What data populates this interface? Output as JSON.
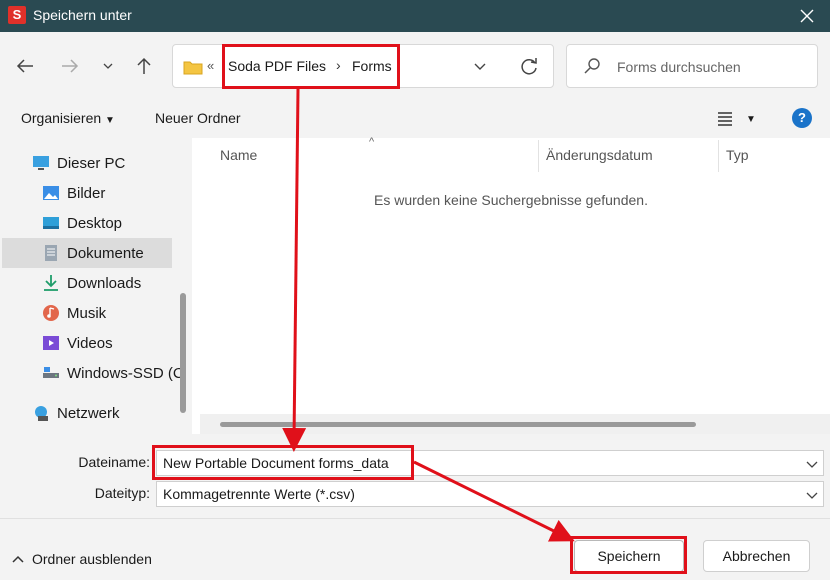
{
  "window": {
    "app_icon_letter": "S",
    "title": "Speichern unter"
  },
  "address": {
    "overflow_chevron": "«",
    "crumbs": [
      "Soda PDF Files",
      "Forms"
    ]
  },
  "search": {
    "placeholder": "Forms durchsuchen"
  },
  "toolbar": {
    "organize": "Organisieren",
    "new_folder": "Neuer Ordner",
    "help": "?"
  },
  "nav": {
    "items": [
      {
        "label": "Dieser PC",
        "icon": "pc-icon"
      },
      {
        "label": "Bilder",
        "icon": "pictures-icon"
      },
      {
        "label": "Desktop",
        "icon": "desktop-icon"
      },
      {
        "label": "Dokumente",
        "icon": "documents-icon",
        "selected": true
      },
      {
        "label": "Downloads",
        "icon": "downloads-icon"
      },
      {
        "label": "Musik",
        "icon": "music-icon"
      },
      {
        "label": "Videos",
        "icon": "videos-icon"
      },
      {
        "label": "Windows-SSD (C",
        "icon": "drive-icon"
      },
      {
        "label": "Netzwerk",
        "icon": "network-icon"
      }
    ]
  },
  "files": {
    "columns": [
      "Name",
      "Änderungsdatum",
      "Typ"
    ],
    "empty_message": "Es wurden keine Suchergebnisse gefunden."
  },
  "form": {
    "filename_label": "Dateiname:",
    "filename_value": "New Portable Document forms_data",
    "filetype_label": "Dateityp:",
    "filetype_value": "Kommagetrennte Werte (*.csv)"
  },
  "footer": {
    "hide_folders": "Ordner ausblenden",
    "save": "Speichern",
    "cancel": "Abbrechen"
  },
  "colors": {
    "titlebar": "#2a4a52",
    "annotation": "#e0101a",
    "accent": "#1a73c9"
  }
}
